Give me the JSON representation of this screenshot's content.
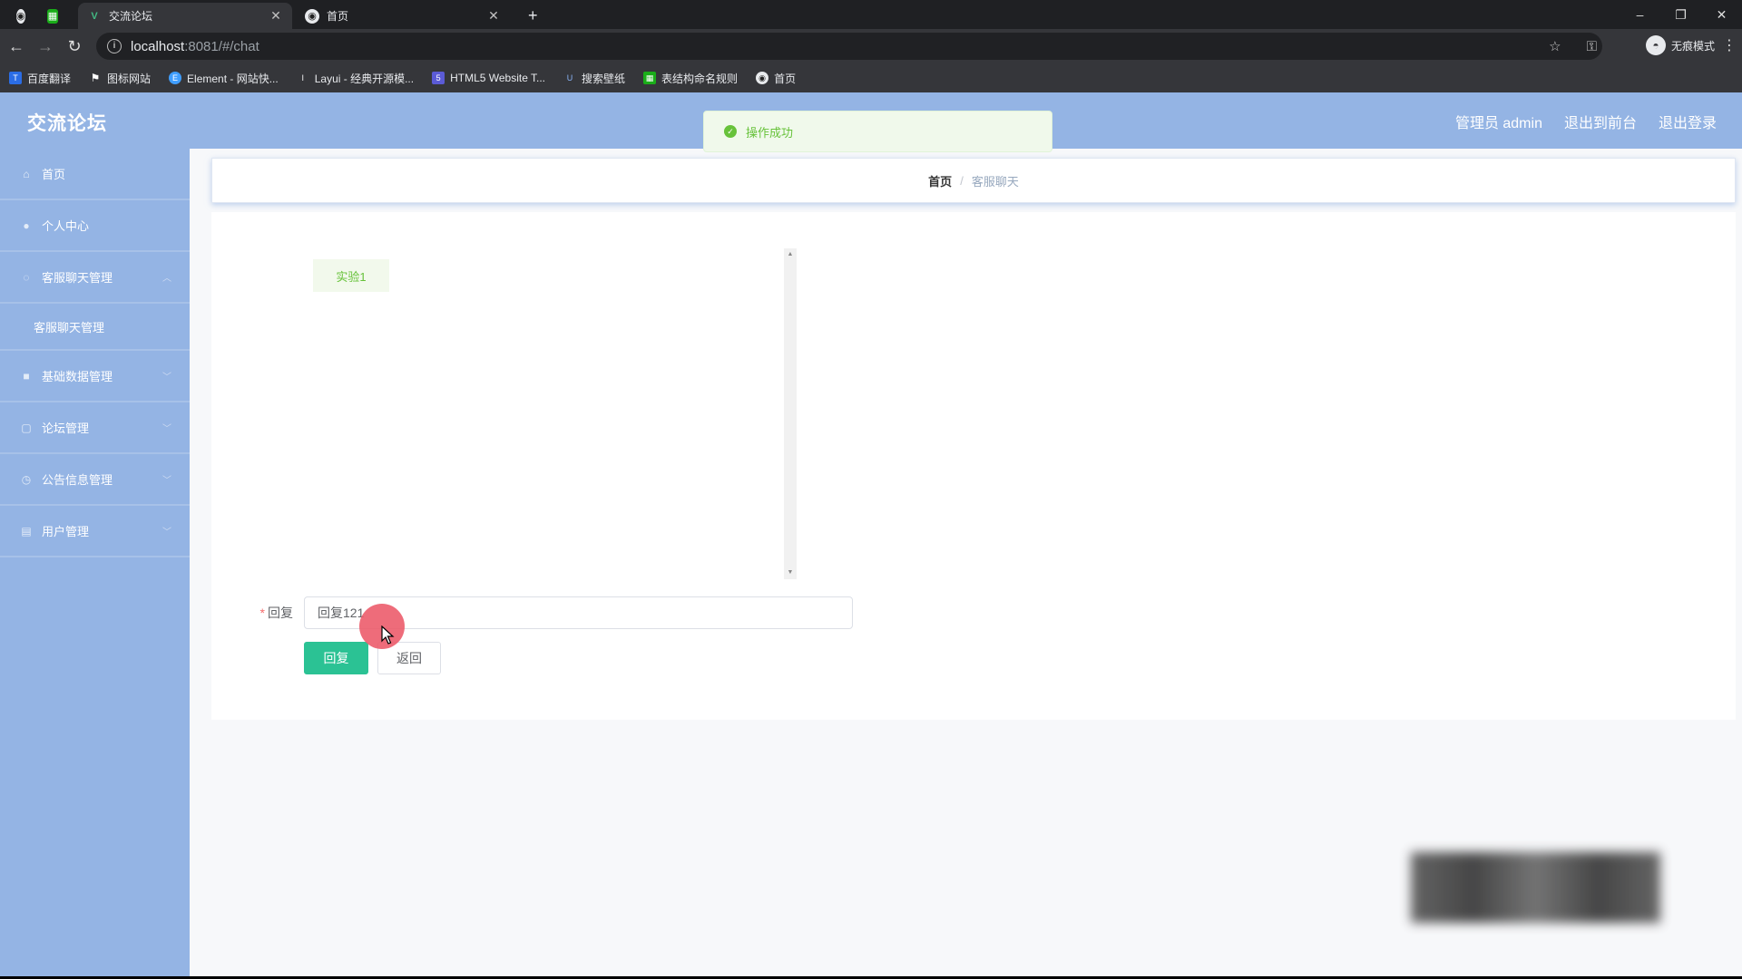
{
  "browser": {
    "tabs": [
      {
        "title": "交流论坛",
        "active": true
      },
      {
        "title": "首页",
        "active": false
      }
    ],
    "url_host": "localhost",
    "url_path": ":8081/#/chat",
    "incognito_label": "无痕模式",
    "bookmarks": [
      {
        "label": "百度翻译",
        "color": "#2b6de5"
      },
      {
        "label": "图标网站",
        "color": "#444444"
      },
      {
        "label": "Element - 网站快...",
        "color": "#409eff"
      },
      {
        "label": "Layui - 经典开源模...",
        "color": "#333333"
      },
      {
        "label": "HTML5 Website T...",
        "color": "#5b5bd6"
      },
      {
        "label": "搜索壁纸",
        "color": "#3a7bd5"
      },
      {
        "label": "表结构命名规则",
        "color": "#1aad19"
      },
      {
        "label": "首页",
        "color": "#666666"
      }
    ]
  },
  "app": {
    "logo": "交流论坛",
    "header_links": [
      "管理员 admin",
      "退出到前台",
      "退出登录"
    ],
    "accent_color": "#94b4e4",
    "sidebar": {
      "items": [
        {
          "label": "首页",
          "icon": "home-icon"
        },
        {
          "label": "个人中心",
          "icon": "user-icon"
        },
        {
          "label": "客服聊天管理",
          "icon": "chat-icon"
        },
        {
          "label": "基础数据管理",
          "icon": "database-icon"
        },
        {
          "label": "论坛管理",
          "icon": "forum-icon"
        },
        {
          "label": "公告信息管理",
          "icon": "notice-icon"
        },
        {
          "label": "用户管理",
          "icon": "users-icon"
        }
      ],
      "submenu": [
        "客服聊天管理"
      ]
    },
    "breadcrumb": {
      "home": "首页",
      "current": "客服聊天"
    },
    "chat": {
      "messages": [
        "实验1"
      ]
    },
    "form": {
      "reply_label": "回复",
      "reply_value": "回复121",
      "submit_label": "回复",
      "back_label": "返回"
    },
    "toast": {
      "message": "操作成功",
      "type": "success",
      "color": "#67c23a"
    }
  }
}
